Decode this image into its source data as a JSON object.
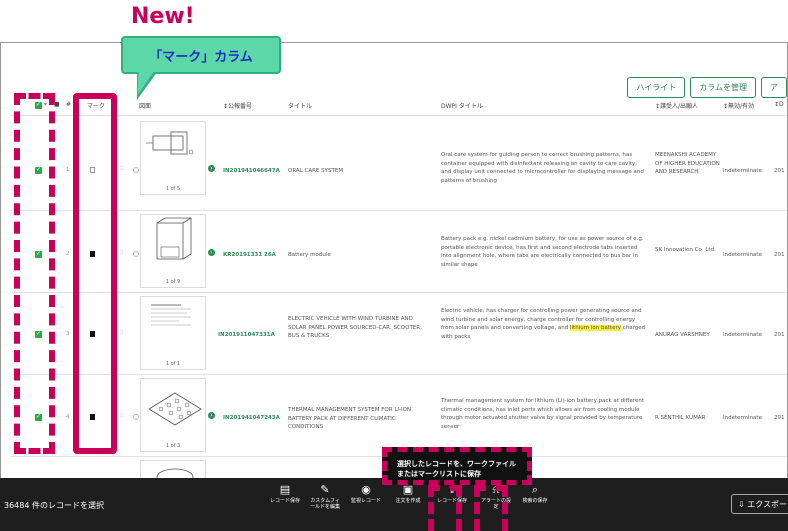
{
  "new_label": "New!",
  "callout_text": "「マーク」カラム",
  "top_buttons": [
    "ハイライト",
    "カラムを管理",
    "ア"
  ],
  "headers": {
    "hash": "#",
    "mark": "マーク",
    "drawing": "図面",
    "pubno": "↕公報番号",
    "title": "タイトル",
    "dwpi": "DWPI タイトル",
    "applicant": "↕譲受人/出願人",
    "status": "↕無効/有効",
    "date": "↕D"
  },
  "rows": [
    {
      "n": "1",
      "marked": false,
      "thumb_caption": "1 of 5",
      "pubno": "IN201941046647A",
      "title": "ORAL CARE SYSTEM",
      "dwpi": "Oral care system for guiding person to correct brushing patterns, has container equipped with disinfectant releasing on cavity to care cavity, and display unit connected to microcontroller for displaying message and patterns of brushing",
      "dwpi_hl": "",
      "dwpi_tail": "",
      "applicant": "MEENAKSHI ACADEMY OF HIGHER EDUCATION AND RESEARCH",
      "status": "Indeterminate",
      "date": "201"
    },
    {
      "n": "2",
      "marked": true,
      "thumb_caption": "1 of 9",
      "pubno": "KR20191331 26A",
      "title": "Battery module",
      "dwpi": "Battery pack e.g. nickel cadmium battery, for use as power source of e.g. portable electronic device, has first and second electrode tabs inserted into alignment hole, where tabs are electrically connected to bus bar in similar shape",
      "dwpi_hl": "",
      "dwpi_tail": "",
      "applicant": "SK Innovation Co. Ltd.",
      "status": "Indeterminate",
      "date": "201"
    },
    {
      "n": "3",
      "marked": true,
      "thumb_caption": "1 of 1",
      "pubno": "IN201911047331A",
      "title": "ELECTRIC VEHICLE WITH WIND TURBINE AND SOLAR PANEL POWER SOURCED-CAR, SCOOTER, BUS & TRUCKS",
      "dwpi": "Electric vehicle, has charger for controlling power generating source and wind turbine and solar energy, charge controller for controlling energy from solar panels and converting voltage, and ",
      "dwpi_hl": "lithium ion battery",
      "dwpi_tail": " charged with packs",
      "applicant": "ANURAG VARSHNEY",
      "status": "Indeterminate",
      "date": "201"
    },
    {
      "n": "4",
      "marked": true,
      "thumb_caption": "1 of 3",
      "pubno": "IN201941047243A",
      "title": "THERMAL MANAGEMENT SYSTEM FOR LI-ION BATTERY PACK AT DIFFERENT CLIMATIC CONDITIONS",
      "dwpi": "Thermal management system for lithium (Li)-ion battery pack at different climatic conditions, has inlet ports which allows air from cooling module through motor actuated shutter valve by signal provided by temperature sensor",
      "dwpi_hl": "",
      "dwpi_tail": "",
      "applicant": "R SENTHIL KUMAR",
      "status": "Indeterminate",
      "date": "201"
    }
  ],
  "tooltip": "選択したレコードを、ワークファイルまたはマークリストに保存",
  "bottom": {
    "selected": "36484 件のレコードを選択",
    "items": [
      {
        "icon": "▤",
        "label": "レコード保存"
      },
      {
        "icon": "✎",
        "label": "カスタムフィールドを編集"
      },
      {
        "icon": "◉",
        "label": "監視レコード"
      },
      {
        "icon": "▣",
        "label": "注文を作成"
      },
      {
        "icon": "⇪",
        "label": "レコード保存"
      },
      {
        "icon": "⍾",
        "label": "アラートの設定"
      },
      {
        "icon": "⌕",
        "label": "検索の保存"
      }
    ],
    "export": "⇩ エクスポート"
  }
}
